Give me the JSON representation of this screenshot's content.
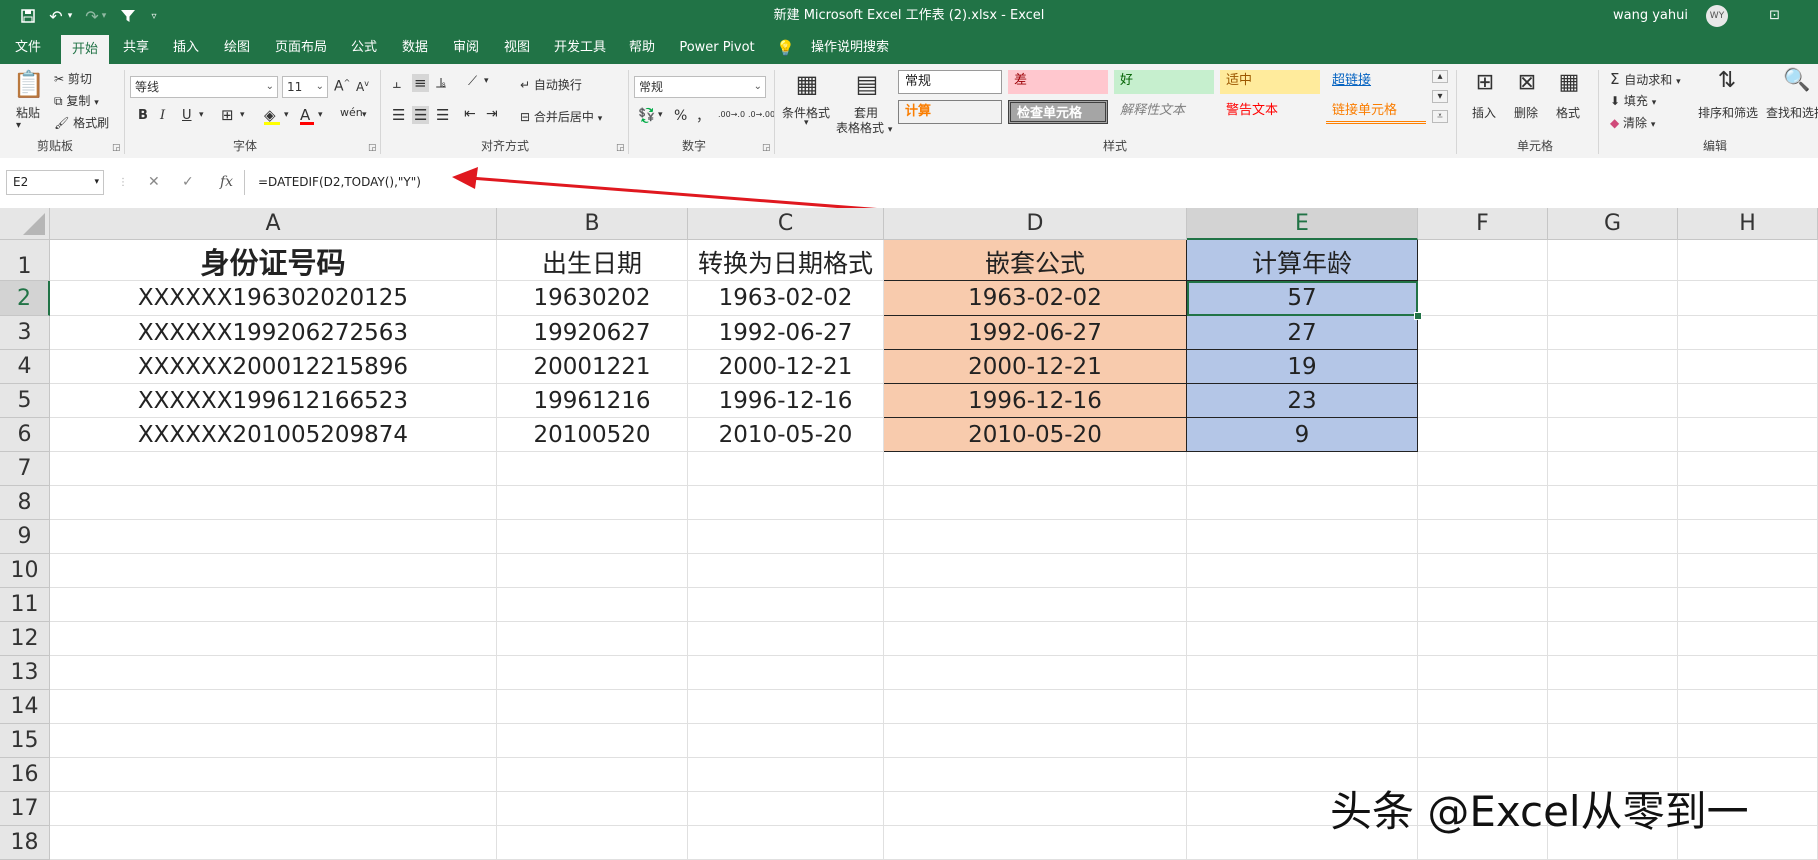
{
  "app": {
    "title": "新建 Microsoft Excel 工作表 (2).xlsx  -  Excel",
    "user": "wang yahui",
    "avatar_initials": "WY",
    "accent_color": "#217346"
  },
  "tabs": [
    "文件",
    "开始",
    "共享",
    "插入",
    "绘图",
    "页面布局",
    "公式",
    "数据",
    "审阅",
    "视图",
    "开发工具",
    "帮助",
    "Power Pivot"
  ],
  "tell_me": "操作说明搜索",
  "ribbon": {
    "clipboard": {
      "paste": "粘贴",
      "cut": "剪切",
      "copy": "复制",
      "format_painter": "格式刷",
      "label": "剪贴板"
    },
    "font": {
      "name": "等线",
      "size": "11",
      "bold": "B",
      "italic": "I",
      "underline": "U",
      "label": "字体",
      "grow": "A",
      "shrink": "A",
      "font_color_glyph": "A",
      "wen": "wén"
    },
    "alignment": {
      "wrap": "自动换行",
      "merge": "合并后居中",
      "label": "对齐方式"
    },
    "number": {
      "format": "常规",
      "percent": "%",
      "comma": "，",
      "inc_decimal": ".00→.0",
      "dec_decimal": ".0→.00",
      "label": "数字"
    },
    "styles": {
      "cond_format": "条件格式",
      "table_format_1": "套用",
      "table_format_2": "表格格式",
      "label": "样式",
      "cells": [
        "常规",
        "差",
        "好",
        "适中",
        "超链接",
        "计算",
        "检查单元格",
        "解释性文本",
        "警告文本",
        "链接单元格"
      ]
    },
    "cells_group": {
      "insert": "插入",
      "delete": "删除",
      "format": "格式",
      "label": "单元格"
    },
    "editing": {
      "autosum": "自动求和",
      "fill": "填充",
      "clear": "清除",
      "sort": "排序和筛选",
      "find": "查找和选择",
      "label": "编辑"
    }
  },
  "formula_bar": {
    "name_box": "E2",
    "formula": "=DATEDIF(D2,TODAY(),\"Y\")"
  },
  "columns": [
    "A",
    "B",
    "C",
    "D",
    "E",
    "F",
    "G",
    "H"
  ],
  "rows": [
    "1",
    "2",
    "3",
    "4",
    "5",
    "6",
    "7",
    "8",
    "9",
    "10",
    "11",
    "12",
    "13",
    "14",
    "15",
    "16",
    "17",
    "18"
  ],
  "sheet": {
    "headers": [
      "身份证号码",
      "出生日期",
      "转换为日期格式",
      "嵌套公式",
      "计算年龄"
    ],
    "data": [
      [
        "XXXXXX196302020125",
        "19630202",
        "1963-02-02",
        "1963-02-02",
        "57"
      ],
      [
        "XXXXXX199206272563",
        "19920627",
        "1992-06-27",
        "1992-06-27",
        "27"
      ],
      [
        "XXXXXX200012215896",
        "20001221",
        "2000-12-21",
        "2000-12-21",
        "19"
      ],
      [
        "XXXXXX199612166523",
        "19961216",
        "1996-12-16",
        "1996-12-16",
        "23"
      ],
      [
        "XXXXXX201005209874",
        "20100520",
        "2010-05-20",
        "2010-05-20",
        "9"
      ]
    ]
  },
  "watermark": "头条 @Excel从零到一"
}
